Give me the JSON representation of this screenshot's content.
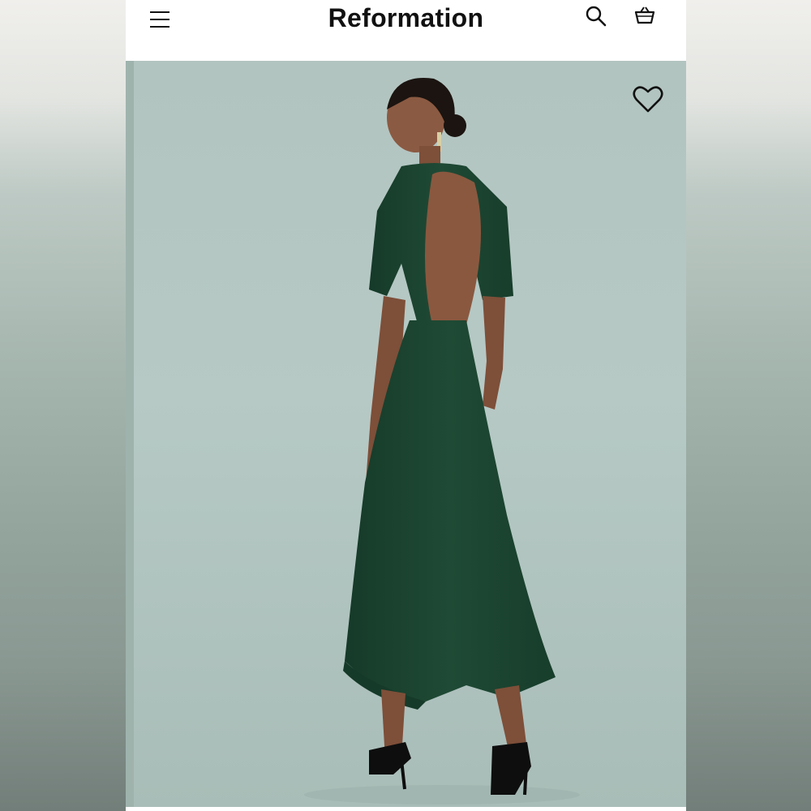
{
  "app": {
    "brand": "Reformation"
  },
  "header": {
    "menu_icon": "hamburger-menu-icon",
    "search_icon": "search-icon",
    "bag_icon": "shopping-bag-icon"
  },
  "product_image": {
    "wishlist_icon": "heart-outline-icon",
    "dress_color": "#1f4a35",
    "background_color": "#b4c7c3"
  }
}
